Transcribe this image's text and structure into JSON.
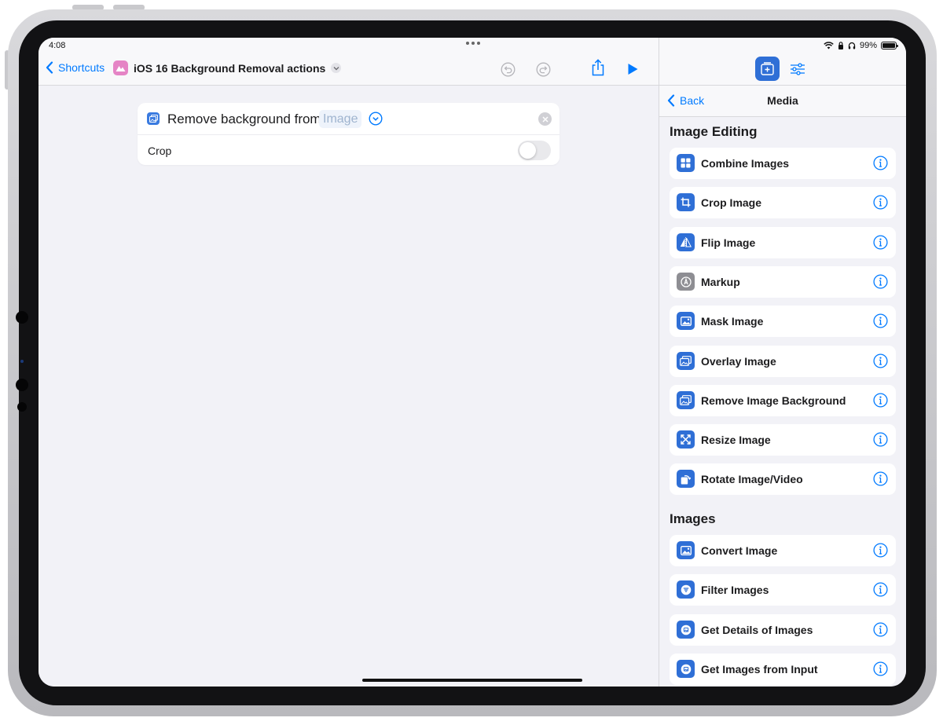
{
  "status_bar": {
    "time": "4:08",
    "battery": "99%",
    "battery_level": 0.99
  },
  "editor": {
    "back_label": "Shortcuts",
    "shortcut_title": "iOS 16 Background Removal actions",
    "action": {
      "text": "Remove background from",
      "parameter": "Image",
      "option_label": "Crop",
      "option_on": false
    }
  },
  "library": {
    "back_label": "Back",
    "title": "Media",
    "sections": [
      {
        "header": "Image Editing",
        "items": [
          {
            "label": "Combine Images",
            "icon": "grid-icon"
          },
          {
            "label": "Crop Image",
            "icon": "crop-icon"
          },
          {
            "label": "Flip Image",
            "icon": "flip-icon"
          },
          {
            "label": "Markup",
            "icon": "markup-icon"
          },
          {
            "label": "Mask Image",
            "icon": "photo-icon"
          },
          {
            "label": "Overlay Image",
            "icon": "photo-stack-icon"
          },
          {
            "label": "Remove Image Background",
            "icon": "photo-stack-icon"
          },
          {
            "label": "Resize Image",
            "icon": "resize-icon"
          },
          {
            "label": "Rotate Image/Video",
            "icon": "rotate-icon"
          }
        ]
      },
      {
        "header": "Images",
        "items": [
          {
            "label": "Convert Image",
            "icon": "photo-icon"
          },
          {
            "label": "Filter Images",
            "icon": "filter-icon"
          },
          {
            "label": "Get Details of Images",
            "icon": "details-icon"
          },
          {
            "label": "Get Images from Input",
            "icon": "details-icon"
          }
        ]
      }
    ]
  },
  "colors": {
    "accent": "#007aff",
    "action_icon_blue": "#2f6fd6",
    "markup_gray": "#8e8e93",
    "app_icon_pink": "#e584c5"
  }
}
